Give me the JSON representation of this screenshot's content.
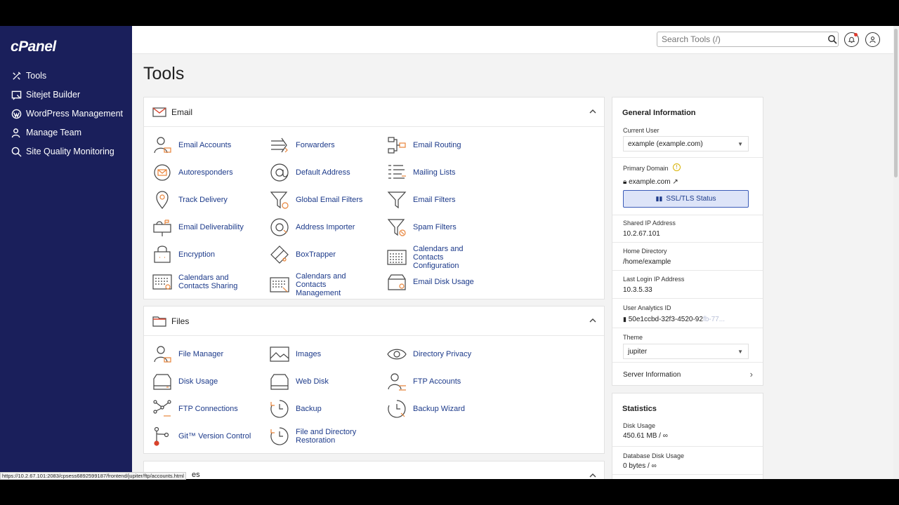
{
  "sidebar": {
    "logo": "cPanel",
    "items": [
      {
        "label": "Tools"
      },
      {
        "label": "Sitejet Builder"
      },
      {
        "label": "WordPress Management"
      },
      {
        "label": "Manage Team"
      },
      {
        "label": "Site Quality Monitoring"
      }
    ]
  },
  "header": {
    "search_placeholder": "Search Tools (/)"
  },
  "page": {
    "title": "Tools"
  },
  "email_panel": {
    "title": "Email",
    "tools": [
      "Email Accounts",
      "Forwarders",
      "Email Routing",
      "Autoresponders",
      "Default Address",
      "Mailing Lists",
      "Track Delivery",
      "Global Email Filters",
      "Email Filters",
      "Email Deliverability",
      "Address Importer",
      "Spam Filters",
      "Encryption",
      "BoxTrapper",
      "Calendars and Contacts Configuration",
      "Calendars and Contacts Sharing",
      "Calendars and Contacts Management",
      "Email Disk Usage"
    ]
  },
  "files_panel": {
    "title": "Files",
    "tools": [
      "File Manager",
      "Images",
      "Directory Privacy",
      "Disk Usage",
      "Web Disk",
      "FTP Accounts",
      "FTP Connections",
      "Backup",
      "Backup Wizard",
      "Git™ Version Control",
      "File and Directory Restoration"
    ]
  },
  "next_panel_title_fragment": "es",
  "general_info": {
    "title": "General Information",
    "current_user_label": "Current User",
    "current_user_value": "example (example.com)",
    "primary_domain_label": "Primary Domain",
    "primary_domain_value": "example.com",
    "ssl_button": "SSL/TLS Status",
    "shared_ip_label": "Shared IP Address",
    "shared_ip_value": "10.2.67.101",
    "home_dir_label": "Home Directory",
    "home_dir_value": "/home/example",
    "last_login_label": "Last Login IP Address",
    "last_login_value": "10.3.5.33",
    "analytics_label": "User Analytics ID",
    "analytics_value": "50e1ccbd-32f3-4520-92",
    "analytics_value_faded": "fb-77...",
    "theme_label": "Theme",
    "theme_value": "jupiter",
    "server_info": "Server Information"
  },
  "statistics": {
    "title": "Statistics",
    "disk_usage_label": "Disk Usage",
    "disk_usage_value": "450.61 MB / ∞",
    "db_disk_label": "Database Disk Usage",
    "db_disk_value": "0 bytes / ∞"
  },
  "status_bar": {
    "url": "https://10.2.67.101:2083/cpsess6892599187/frontend/jupiter/ftp/accounts.html"
  },
  "colors": {
    "sidebar_bg": "#1a1f5b",
    "link": "#1c3a8a",
    "accent_orange": "#e8843a"
  }
}
